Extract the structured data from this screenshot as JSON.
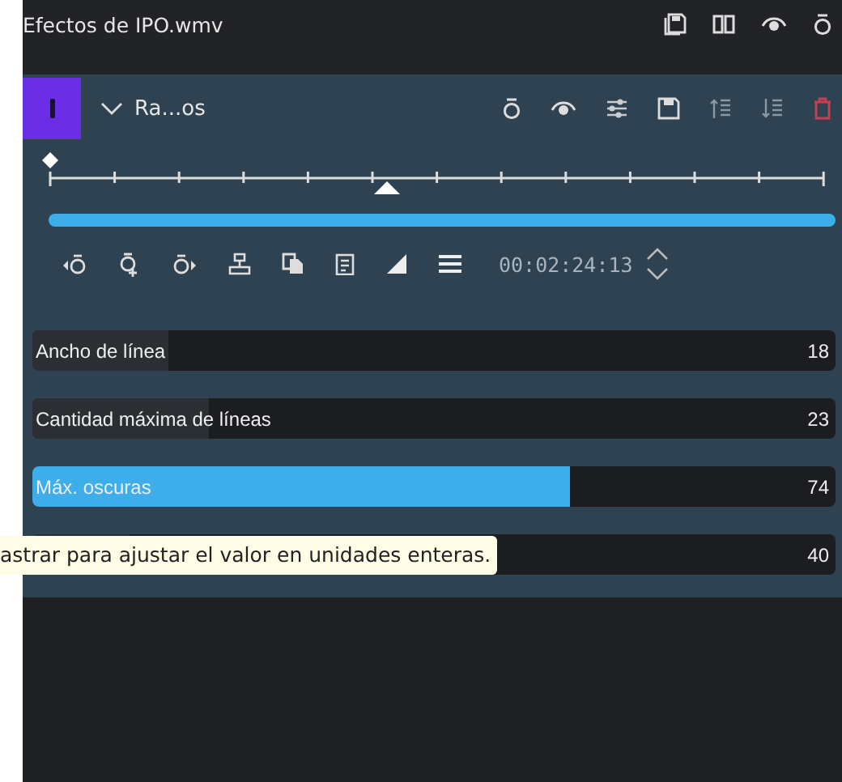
{
  "window": {
    "title": "Efectos de IPO.wmv"
  },
  "effect": {
    "name": "Ra...os",
    "enabled": true,
    "expanded": true
  },
  "timeline": {
    "keyframe": {
      "level": 0
    },
    "playhead": {
      "level": 0.43
    },
    "timecode": "00:02:24:13"
  },
  "parameters": [
    {
      "label": "Ancho de línea",
      "value": "18",
      "level": 0.17,
      "selected": false
    },
    {
      "label": "Cantidad máxima de líneas",
      "value": "23",
      "level": 0.22,
      "selected": false
    },
    {
      "label": "Máx. oscuras",
      "value": "74",
      "level": 0.67,
      "selected": true
    },
    {
      "value": "40",
      "level": 0.12,
      "selected": false
    }
  ],
  "tooltip": {
    "text": "astrar para ajustar el valor en unidades enteras."
  }
}
